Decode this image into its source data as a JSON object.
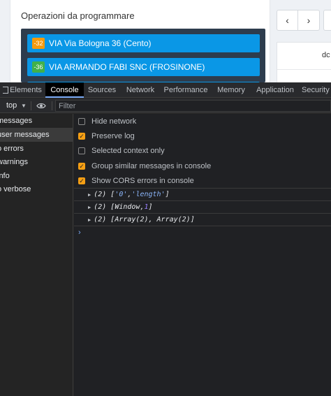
{
  "webpage": {
    "section_title": "Operazioni da programmare",
    "operations": [
      {
        "badge": "-32",
        "badge_color": "#f59a0c",
        "label": "VIA Via Bologna 36 (Cento)"
      },
      {
        "badge": "-36",
        "badge_color": "#41b14a",
        "label": "VIA ARMANDO FABI SNC (FROSINONE)"
      }
    ],
    "nav_prev": "‹",
    "nav_next": "›",
    "right_panel_text": "dc"
  },
  "devtools": {
    "tabs": [
      "Elements",
      "Console",
      "Sources",
      "Network",
      "Performance",
      "Memory",
      "Application",
      "Security"
    ],
    "active_tab": "Console",
    "context": "top",
    "filter_placeholder": "Filter",
    "sidebar": [
      {
        "label": "messages",
        "selected": false
      },
      {
        "label": "user messages",
        "selected": true
      },
      {
        "label": "o errors",
        "selected": false
      },
      {
        "label": "warnings",
        "selected": false
      },
      {
        "label": "info",
        "selected": false
      },
      {
        "label": "o verbose",
        "selected": false
      }
    ],
    "settings": [
      {
        "label": "Hide network",
        "checked": false
      },
      {
        "label": "Preserve log",
        "checked": true
      },
      {
        "label": "Selected context only",
        "checked": false
      },
      {
        "label": "Group similar messages in console",
        "checked": true
      },
      {
        "label": "Show CORS errors in console",
        "checked": true
      }
    ],
    "logs": [
      {
        "prefix": "(2) [",
        "a": "'0'",
        "sep": ", ",
        "b": "'length'",
        "suffix": "]"
      },
      {
        "prefix": "(2) [Window, ",
        "a": "",
        "sep": "",
        "b": "1",
        "suffix": "]"
      },
      {
        "prefix": "(2) [Array(2), Array(2)]",
        "a": "",
        "sep": "",
        "b": "",
        "suffix": ""
      }
    ],
    "prompt": "›"
  },
  "colors": {
    "accent_checkbox": "#f59f14",
    "active_tab_underline": "#7cacf8",
    "operation_bg": "#0a97e6"
  }
}
